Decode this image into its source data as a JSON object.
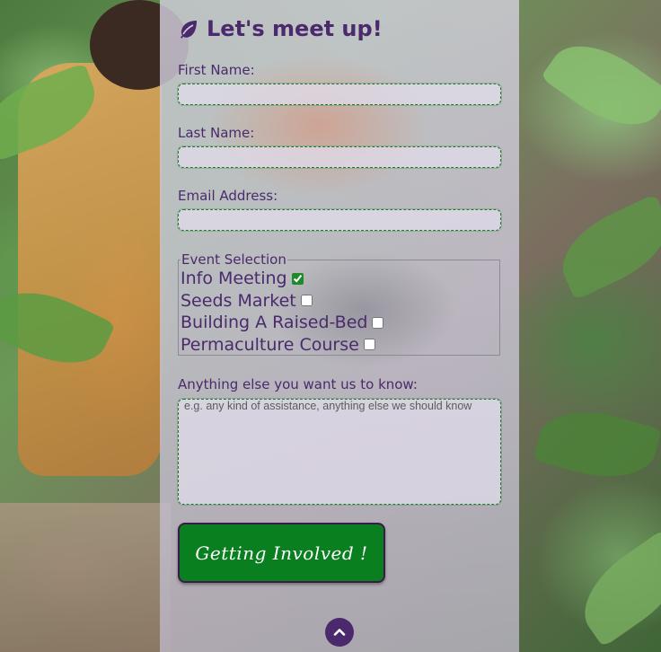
{
  "form": {
    "title": "Let's meet up!",
    "title_icon": "leaf-icon",
    "first_name_label": "First Name:",
    "first_name_value": "",
    "last_name_label": "Last Name:",
    "last_name_value": "",
    "email_label": "Email Address:",
    "email_value": "",
    "event_legend": "Event Selection",
    "events": [
      {
        "label": "Info Meeting",
        "checked": true
      },
      {
        "label": "Seeds Market",
        "checked": false
      },
      {
        "label": "Building A Raised-Bed",
        "checked": false
      },
      {
        "label": "Permaculture Course",
        "checked": false
      }
    ],
    "notes_label": "Anything else you want us to know:",
    "notes_placeholder": "e.g. any kind of assistance, anything else we should know",
    "submit_label": "Getting Involved !"
  },
  "page": {
    "back_to_top_icon": "chevron-up-icon"
  },
  "colors": {
    "heading": "#4a2a6d",
    "accent_green": "#0a7f1f",
    "panel": "#d2cedc"
  }
}
